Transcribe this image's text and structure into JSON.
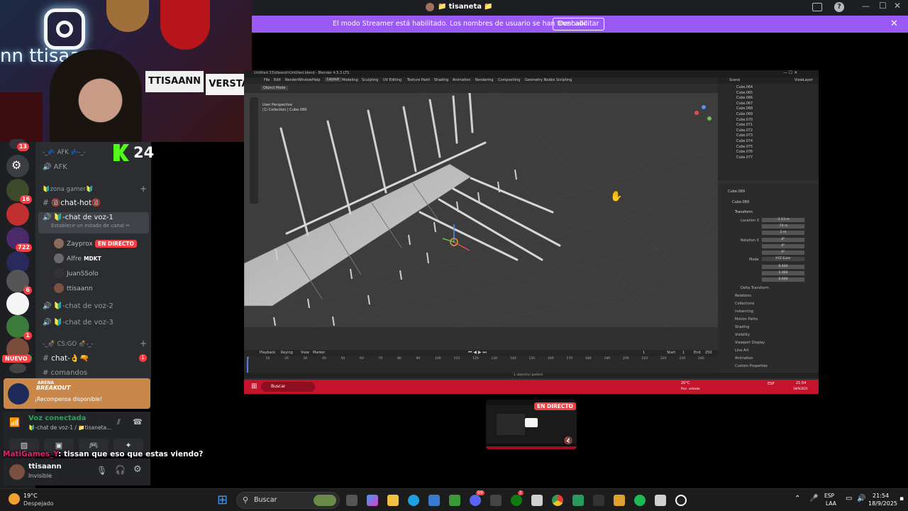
{
  "discord": {
    "title": "tisaneta",
    "title_emoji": "📁",
    "streamer_banner": "El modo Streamer está habilitado. Los nombres de usuario se han truncado.",
    "disable_label": "Deshabilitar",
    "rail_badges": [
      "13",
      "16",
      "722",
      "6",
      "1",
      "1"
    ],
    "nuevo_label": "NUEVO",
    "kick_number": "24",
    "channels": {
      "afk_category": "-_💤 AFK 💤-_-",
      "afk_channel": "AFK",
      "zona_category": "🔰zona gamer🔰",
      "chat_hot": "🔞chat-hot🔞",
      "chat_voz_1": "🔰-chat de voz-1",
      "status_hint": "Establece un estado de canal ✏",
      "users": [
        {
          "name": "Zayprox",
          "badge": "EN DIRECTO"
        },
        {
          "name": "Alfre",
          "tag": "MDKT"
        },
        {
          "name": "JuanSSolo"
        },
        {
          "name": "ttisaann"
        }
      ],
      "chat_voz_2": "🔰-chat de voz-2",
      "chat_voz_3": "🔰-chat de voz-3",
      "csgo_category": "-_💣 CS:GO 💣-_-",
      "chat_csgo": "chat-👌🔫",
      "chat_csgo_badge": "1",
      "comandos": "comandos"
    },
    "arena": {
      "logo_line1": "ARENA",
      "logo_line2": "BREAKOUT",
      "reward": "¡Recompensa disponible!"
    },
    "voice": {
      "status": "Voz conectada",
      "channel": "🔰-chat de voz-1 / 📁tisaneta..."
    },
    "user": {
      "name": "ttisaann",
      "status": "Invisible"
    },
    "chat": {
      "author": "MatiGames_Y",
      "message": ": tissan que eso que estas viendo?"
    }
  },
  "blender": {
    "title": "Untitled 33\\dleandr\\Untitled.blend - Blender 4.5.3 LTS",
    "menus": [
      "File",
      "Edit",
      "Render",
      "Window",
      "Help"
    ],
    "workspaces": [
      "Layout",
      "Modeling",
      "Sculpting",
      "UV Editing",
      "Texture Paint",
      "Shading",
      "Animation",
      "Rendering",
      "Compositing",
      "Geometry Nodes",
      "Scripting"
    ],
    "mode": "Object Mode",
    "viewport_info_1": "User Perspective",
    "viewport_info_2": "(1) Collection | Cube.089",
    "scene": "Scene",
    "view_layer": "ViewLayer",
    "outliner_items": [
      "Cube.064",
      "Cube.065",
      "Cube.066",
      "Cube.067",
      "Cube.068",
      "Cube.069",
      "Cube.070",
      "Cube.071",
      "Cube.072",
      "Cube.073",
      "Cube.074",
      "Cube.075",
      "Cube.076",
      "Cube.077"
    ],
    "active_object": "Cube.089",
    "props": {
      "transform": "Transform",
      "location_x": "-1.13 m",
      "location_y": "-74 m",
      "location_z": "2 m",
      "rotation_x": "0°",
      "rotation_y": "0°",
      "rotation_z": "0°",
      "mode_value": "XYZ Euler",
      "scale_x": "0.400",
      "scale_y": "1.000",
      "scale_z": "0.600",
      "sections": [
        "Delta Transform",
        "Relations",
        "Collections",
        "Instancing",
        "Motion Paths",
        "Shading",
        "Visibility",
        "Viewport Display",
        "Line Art",
        "Animation",
        "Custom Properties"
      ]
    },
    "timeline": {
      "menus": [
        "Playback",
        "Keying",
        "View",
        "Marker"
      ],
      "current": "1",
      "start": "1",
      "end": "250",
      "ticks": [
        "0",
        "10",
        "20",
        "30",
        "40",
        "50",
        "60",
        "70",
        "80",
        "90",
        "100",
        "110",
        "120",
        "130",
        "140",
        "150",
        "160",
        "170",
        "180",
        "190",
        "200",
        "210",
        "220",
        "230",
        "240"
      ]
    },
    "status": "1 object(s) pasted",
    "taskbar_search": "Buscar",
    "taskbar_weather": "20°C",
    "taskbar_weather_sub": "Parc. soleado",
    "taskbar_lang": "ESP",
    "taskbar_time": "21:54",
    "taskbar_date": "18/9/2025"
  },
  "preview": {
    "live": "EN DIRECTO"
  },
  "taskbar": {
    "temp": "19°C",
    "weather": "Despejado",
    "search": "Buscar",
    "lang1": "ESP",
    "lang2": "LAA",
    "time": "21:54",
    "date": "18/9/2025",
    "badge1": "99",
    "badge2": "2"
  }
}
